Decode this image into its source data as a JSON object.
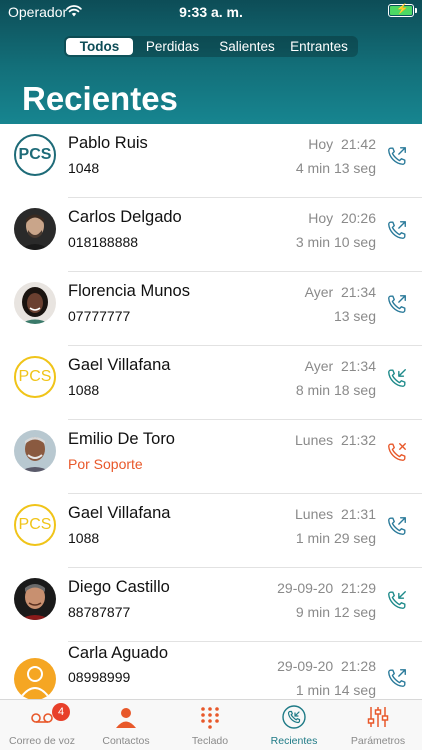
{
  "status_bar": {
    "carrier": "Operador",
    "time": "9:33 a. m."
  },
  "filter_tabs": [
    {
      "label": "Todos",
      "active": true
    },
    {
      "label": "Perdidas",
      "active": false
    },
    {
      "label": "Salientes",
      "active": false
    },
    {
      "label": "Entrantes",
      "active": false
    }
  ],
  "title": "Recientes",
  "colors": {
    "header": "#13707a",
    "accent": "#1e7a86",
    "missed": "#e8582a",
    "pcs_yellow": "#f0c419",
    "badge": "#e8402a"
  },
  "calls": [
    {
      "name": "Pablo Ruis",
      "detail": "1048",
      "day": "Hoy",
      "time": "21:42",
      "duration": "4 min 13 seg",
      "avatar": "PCS",
      "avatar_style": "pcs-teal",
      "direction": "outgoing-icon"
    },
    {
      "name": "Carlos Delgado",
      "detail": "018188888",
      "day": "Hoy",
      "time": "20:26",
      "duration": "3 min 10 seg",
      "avatar": "",
      "avatar_style": "photo",
      "direction": "outgoing-icon"
    },
    {
      "name": "Florencia Munos",
      "detail": "07777777",
      "day": "Ayer",
      "time": "21:34",
      "duration": "13 seg",
      "avatar": "",
      "avatar_style": "photo",
      "direction": "outgoing-icon"
    },
    {
      "name": "Gael Villafana",
      "detail": "1088",
      "day": "Ayer",
      "time": "21:34",
      "duration": "8 min 18 seg",
      "avatar": "PCS",
      "avatar_style": "pcs-yellow",
      "direction": "incoming-icon"
    },
    {
      "name": "Emilio De Toro",
      "detail": "Por Soporte",
      "day": "Lunes",
      "time": "21:32",
      "duration": "",
      "avatar": "",
      "avatar_style": "photo",
      "direction": "missed-icon"
    },
    {
      "name": "Gael Villafana",
      "detail": "1088",
      "day": "Lunes",
      "time": "21:31",
      "duration": "1 min 29 seg",
      "avatar": "PCS",
      "avatar_style": "pcs-yellow",
      "direction": "outgoing-icon"
    },
    {
      "name": "Diego Castillo",
      "detail": "88787877",
      "day": "29-09-20",
      "time": "21:29",
      "duration": "9 min 12 seg",
      "avatar": "",
      "avatar_style": "photo",
      "direction": "incoming-icon"
    },
    {
      "name": "Carla Aguado",
      "detail": "08998999",
      "day": "29-09-20",
      "time": "21:28",
      "duration": "1 min 14 seg",
      "avatar": "",
      "avatar_style": "placeholder",
      "direction": "outgoing-icon"
    }
  ],
  "tabbar": [
    {
      "label": "Correo de voz",
      "icon": "voicemail-icon",
      "badge": "4",
      "active": false
    },
    {
      "label": "Contactos",
      "icon": "contacts-icon",
      "active": false
    },
    {
      "label": "Teclado",
      "icon": "keypad-icon",
      "active": false
    },
    {
      "label": "Recientes",
      "icon": "recents-icon",
      "active": true
    },
    {
      "label": "Parámetros",
      "icon": "settings-sliders-icon",
      "active": false
    }
  ]
}
